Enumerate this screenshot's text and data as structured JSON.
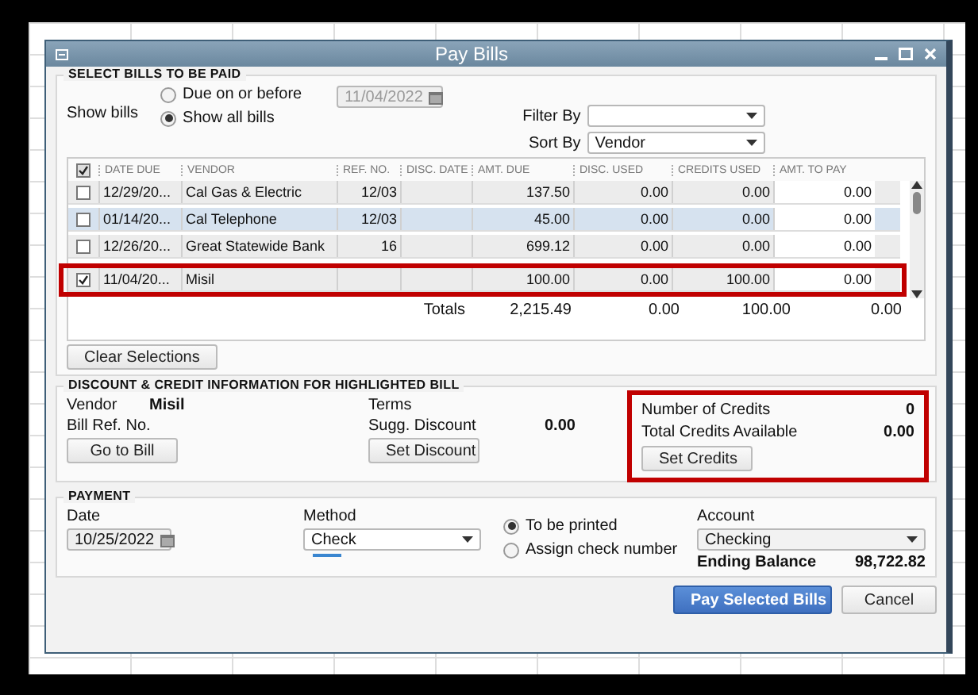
{
  "window": {
    "title": "Pay Bills"
  },
  "select_section": {
    "title": "SELECT BILLS TO BE PAID",
    "show_bills_label": "Show bills",
    "options": [
      {
        "label": "Due on or before",
        "selected": false
      },
      {
        "label": "Show all bills",
        "selected": true
      }
    ],
    "due_date": {
      "value": "11/04/2022",
      "disabled": true
    },
    "filter_by": {
      "label": "Filter By"
    },
    "sort_by": {
      "label": "Sort By",
      "value": "Vendor"
    }
  },
  "table": {
    "select_all_checked": true,
    "columns": [
      "DATE DUE",
      "VENDOR",
      "REF. NO.",
      "DISC. DATE",
      "AMT. DUE",
      "DISC. USED",
      "CREDITS USED",
      "AMT. TO PAY"
    ],
    "rows": [
      {
        "checked": false,
        "selected": false,
        "annotated": false,
        "cells": [
          "12/29/20...",
          "Cal Gas & Electric",
          "12/03",
          "",
          "137.50",
          "0.00",
          "0.00",
          "0.00"
        ]
      },
      {
        "checked": false,
        "selected": true,
        "annotated": false,
        "cells": [
          "01/14/20...",
          "Cal Telephone",
          "12/03",
          "",
          "45.00",
          "0.00",
          "0.00",
          "0.00"
        ]
      },
      {
        "checked": false,
        "selected": false,
        "annotated": false,
        "cells": [
          "12/26/20...",
          "Great Statewide Bank",
          "16",
          "",
          "699.12",
          "0.00",
          "0.00",
          "0.00"
        ]
      },
      {
        "checked": true,
        "selected": false,
        "annotated": true,
        "cells": [
          "11/04/20...",
          "Misil",
          "",
          "",
          "100.00",
          "0.00",
          "100.00",
          "0.00"
        ]
      }
    ],
    "totals": {
      "label": "Totals",
      "values": [
        "2,215.49",
        "0.00",
        "100.00",
        "0.00"
      ]
    }
  },
  "clear_button": "Clear Selections",
  "discount_section": {
    "title": "DISCOUNT & CREDIT INFORMATION FOR HIGHLIGHTED BILL",
    "vendor_label": "Vendor",
    "vendor": "Misil",
    "bill_ref_label": "Bill Ref. No.",
    "go_to_bill": "Go to Bill",
    "terms_label": "Terms",
    "sugg_discount_label": "Sugg. Discount",
    "sugg_discount": "0.00",
    "set_discount": "Set Discount",
    "credits": {
      "annotated": true,
      "number_label": "Number of Credits",
      "number": "0",
      "total_label": "Total Credits Available",
      "total": "0.00",
      "set_credits": "Set Credits"
    }
  },
  "payment": {
    "title": "PAYMENT",
    "date_label": "Date",
    "date": "10/25/2022",
    "method_label": "Method",
    "method": "Check",
    "print_options": [
      {
        "label": "To be printed",
        "selected": true
      },
      {
        "label": "Assign check number",
        "selected": false
      }
    ],
    "account_label": "Account",
    "account": "Checking",
    "ending_balance_label": "Ending Balance",
    "ending_balance": "98,722.82"
  },
  "buttons": [
    {
      "label": "Pay Selected Bills",
      "kind": "primary"
    },
    {
      "label": "Cancel",
      "kind": "secondary"
    }
  ]
}
